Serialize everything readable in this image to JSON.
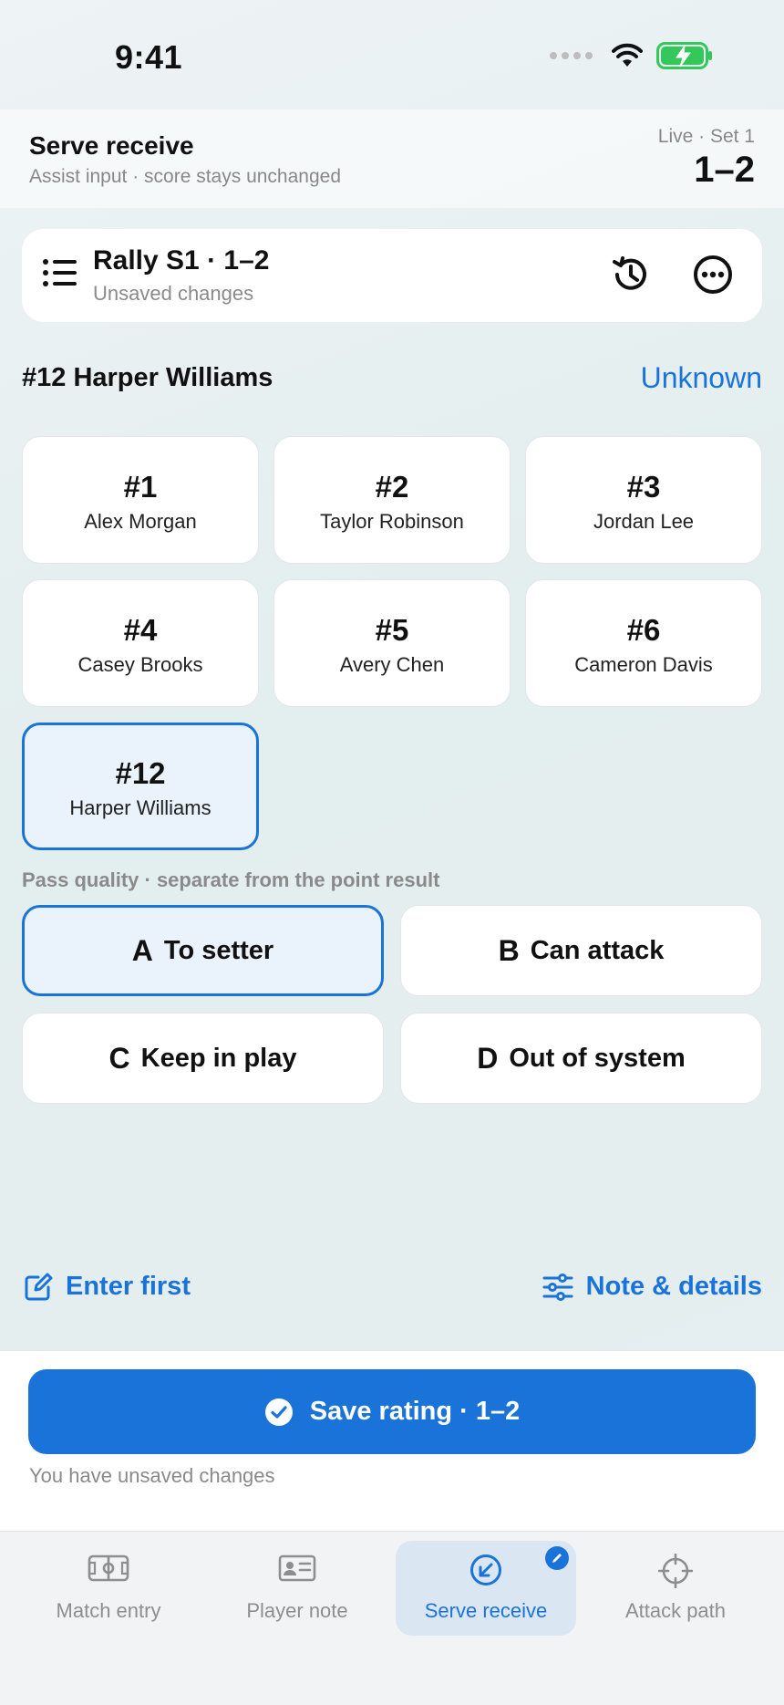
{
  "status_bar": {
    "time": "9:41"
  },
  "header": {
    "title": "Serve receive",
    "subtitle": "Assist input · score stays unchanged",
    "live": "Live · Set 1",
    "score": "1–2"
  },
  "rally": {
    "title": "Rally S1 · 1–2",
    "subtitle": "Unsaved changes"
  },
  "selected_player": {
    "label": "#12 Harper Williams",
    "unknown_link": "Unknown"
  },
  "players": [
    {
      "number": "#1",
      "name": "Alex Morgan",
      "selected": false
    },
    {
      "number": "#2",
      "name": "Taylor Robinson",
      "selected": false
    },
    {
      "number": "#3",
      "name": "Jordan Lee",
      "selected": false
    },
    {
      "number": "#4",
      "name": "Casey Brooks",
      "selected": false
    },
    {
      "number": "#5",
      "name": "Avery Chen",
      "selected": false
    },
    {
      "number": "#6",
      "name": "Cameron Davis",
      "selected": false
    },
    {
      "number": "#12",
      "name": "Harper Williams",
      "selected": true
    }
  ],
  "pass_quality": {
    "label": "Pass quality · separate from the point result",
    "options": [
      {
        "letter": "A",
        "text": "To setter",
        "selected": true
      },
      {
        "letter": "B",
        "text": "Can attack",
        "selected": false
      },
      {
        "letter": "C",
        "text": "Keep in play",
        "selected": false
      },
      {
        "letter": "D",
        "text": "Out of system",
        "selected": false
      }
    ]
  },
  "actions": {
    "enter_first": "Enter first",
    "note_details": "Note & details"
  },
  "save": {
    "button": "Save rating · 1–2",
    "note": "You have unsaved changes"
  },
  "tabs": [
    {
      "label": "Match entry",
      "icon": "court-icon",
      "active": false
    },
    {
      "label": "Player note",
      "icon": "id-card-icon",
      "active": false
    },
    {
      "label": "Serve receive",
      "icon": "receive-arrow-icon",
      "active": true
    },
    {
      "label": "Attack path",
      "icon": "crosshair-icon",
      "active": false
    }
  ],
  "colors": {
    "accent": "#1a73d9",
    "selected_bg": "#eaf2fc",
    "muted_text": "#8a8a8a"
  }
}
